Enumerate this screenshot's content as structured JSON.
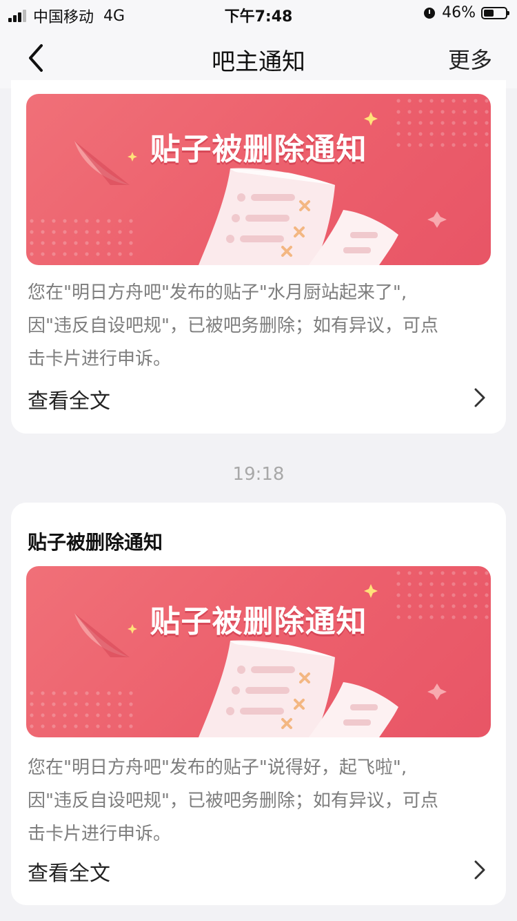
{
  "status_bar": {
    "carrier": "中国移动",
    "network": "4G",
    "time": "下午7:48",
    "battery_percent": "46%",
    "battery_level": 0.46
  },
  "nav": {
    "title": "吧主通知",
    "more": "更多"
  },
  "notices": [
    {
      "banner_title": "贴子被删除通知",
      "body_line1": "您在\"明日方舟吧\"发布的贴子\"水月厨站起来了\",",
      "body_line2": "因\"违反自设吧规\"，已被吧务删除；如有异议，可点",
      "body_line3": "击卡片进行申诉。",
      "read_more": "查看全文"
    },
    {
      "time": "19:18",
      "title": "贴子被删除通知",
      "banner_title": "贴子被删除通知",
      "body_line1": "您在\"明日方舟吧\"发布的贴子\"说得好，起飞啦\",",
      "body_line2": "因\"违反自设吧规\"，已被吧务删除；如有异议，可点",
      "body_line3": "击卡片进行申诉。",
      "read_more": "查看全文"
    }
  ],
  "colors": {
    "banner_red": "#ec5f6c",
    "background": "#f2f2f5",
    "body_text": "#7d7d7d"
  }
}
